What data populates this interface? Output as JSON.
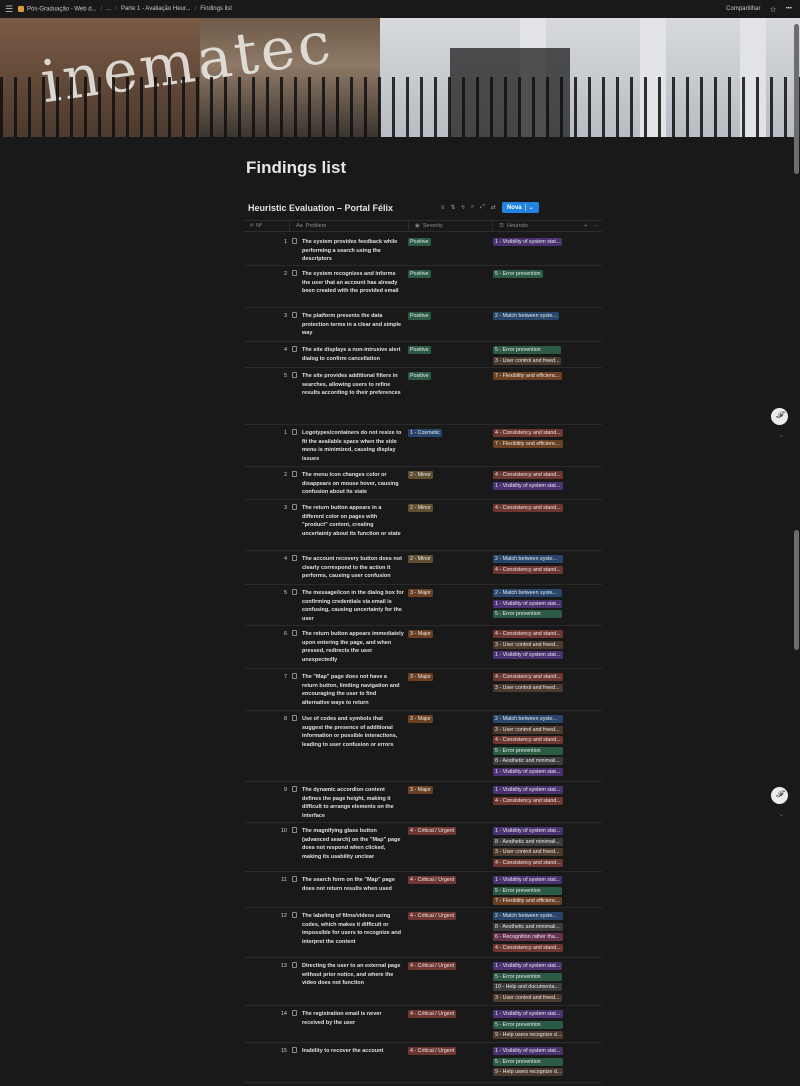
{
  "topbar": {
    "crumbs": [
      "Pós-Graduação - Web d...",
      "...",
      "Parte 1 - Avaliação Heur...",
      "Findings list"
    ],
    "share_label": "Compartilhar",
    "star_icon": "star-icon"
  },
  "cover": {
    "text": "inematec"
  },
  "page": {
    "title": "Findings list"
  },
  "database": {
    "title": "Heuristic Evaluation – Portal Félix",
    "new_label": "Nova",
    "columns": {
      "number": "Nº",
      "problem": "Problem",
      "severity": "Severity",
      "heuristic": "Heuristic"
    }
  },
  "colors": {
    "green": "#2b5a45",
    "blue": "#28456c",
    "yellow": "#5e5030",
    "orange": "#6a3f22",
    "red": "#6e3630",
    "purple": "#4a3270",
    "gray": "#3c3c3c",
    "brown": "#4d3a2f",
    "pink": "#67324e",
    "accent": "#2383e2"
  },
  "rows": [
    {
      "no": "1",
      "problem": "The system provides feedback while performing a search using the descriptors",
      "severity": {
        "label": "Positive",
        "color": "green"
      },
      "heuristics": [
        {
          "label": "1 - Visibility of system stat...",
          "color": "purple"
        }
      ]
    },
    {
      "no": "2",
      "problem": "The system recognizes and informs the user that an account has already been created with the provided email",
      "severity": {
        "label": "Positive",
        "color": "green"
      },
      "heuristics": [
        {
          "label": "5 - Error prevention",
          "color": "green"
        }
      ]
    },
    {
      "no": "3",
      "problem": "The platform presents the data protection terms in a clear and simple way",
      "severity": {
        "label": "Positive",
        "color": "green"
      },
      "heuristics": [
        {
          "label": "2 - Match between syste...",
          "color": "blue"
        }
      ]
    },
    {
      "no": "4",
      "problem": "The site displays a non-intrusive alert dialog to confirm cancellation",
      "severity": {
        "label": "Positive",
        "color": "green"
      },
      "heuristics": [
        {
          "label": "5 - Error prevention",
          "color": "green"
        },
        {
          "label": "3 - User control and freed...",
          "color": "brown"
        }
      ]
    },
    {
      "no": "5",
      "problem": "The site provides additional filters in searches, allowing users to refine results according to their preferences",
      "severity": {
        "label": "Positive",
        "color": "green"
      },
      "heuristics": [
        {
          "label": "7 - Flexibility and efficienc...",
          "color": "orange"
        }
      ]
    },
    {
      "no": "",
      "problem": "",
      "severity": null,
      "heuristics": []
    },
    {
      "no": "1",
      "problem": "Logotypes/containers do not resize to fit the available space when the side menu is minimized, causing display issues",
      "severity": {
        "label": "1 - Cosmetic",
        "color": "blue"
      },
      "heuristics": [
        {
          "label": "4 - Consistency and stand...",
          "color": "red"
        },
        {
          "label": "7 - Flexibility and efficienc...",
          "color": "orange"
        }
      ]
    },
    {
      "no": "2",
      "problem": "The menu icon changes color or disappears on mouse hover, causing confusion about its state",
      "severity": {
        "label": "2 - Minor",
        "color": "yellow"
      },
      "heuristics": [
        {
          "label": "4 - Consistency and stand...",
          "color": "red"
        },
        {
          "label": "1 - Visibility of system stat...",
          "color": "purple"
        }
      ]
    },
    {
      "no": "3",
      "problem": "The return button appears in a different color on pages with \"product\" content, creating uncertainty about its function or state",
      "severity": {
        "label": "2 - Minor",
        "color": "yellow"
      },
      "heuristics": [
        {
          "label": "4 - Consistency and stand...",
          "color": "red"
        }
      ]
    },
    {
      "no": "4",
      "problem": "The account recovery button does not clearly correspond to the action it performs, causing user confusion",
      "severity": {
        "label": "2 - Minor",
        "color": "yellow"
      },
      "heuristics": [
        {
          "label": "2 - Match between syste...",
          "color": "blue"
        },
        {
          "label": "4 - Consistency and stand...",
          "color": "red"
        }
      ]
    },
    {
      "no": "5",
      "problem": "The message/icon in the dialog box for confirming credentials via email is confusing, causing uncertainty for the user",
      "severity": {
        "label": "3 - Major",
        "color": "orange"
      },
      "heuristics": [
        {
          "label": "2 - Match between syste...",
          "color": "blue"
        },
        {
          "label": "1 - Visibility of system stat...",
          "color": "purple"
        },
        {
          "label": "5 - Error prevention",
          "color": "green"
        }
      ]
    },
    {
      "no": "6",
      "problem": "The return button appears immediately upon entering the page, and when pressed, redirects the user unexpectedly",
      "severity": {
        "label": "3 - Major",
        "color": "orange"
      },
      "heuristics": [
        {
          "label": "4 - Consistency and stand...",
          "color": "red"
        },
        {
          "label": "3 - User control and freed...",
          "color": "brown"
        },
        {
          "label": "1 - Visibility of system stat...",
          "color": "purple"
        }
      ]
    },
    {
      "no": "7",
      "problem": "The \"Map\" page does not have a return button, limiting navigation and encouraging the user to find alternative ways to return",
      "severity": {
        "label": "3 - Major",
        "color": "orange"
      },
      "heuristics": [
        {
          "label": "4 - Consistency and stand...",
          "color": "red"
        },
        {
          "label": "3 - User control and freed...",
          "color": "brown"
        }
      ]
    },
    {
      "no": "8",
      "problem": "Use of codes and symbols that suggest the presence of additional information or possible interactions, leading to user confusion or errors",
      "severity": {
        "label": "3 - Major",
        "color": "orange"
      },
      "heuristics": [
        {
          "label": "2 - Match between syste...",
          "color": "blue"
        },
        {
          "label": "3 - User control and freed...",
          "color": "brown"
        },
        {
          "label": "4 - Consistency and stand...",
          "color": "red"
        },
        {
          "label": "5 - Error prevention",
          "color": "green"
        },
        {
          "label": "8 - Aesthetic and minimali...",
          "color": "gray"
        },
        {
          "label": "1 - Visibility of system stat...",
          "color": "purple"
        }
      ]
    },
    {
      "no": "9",
      "problem": "The dynamic accordion content defines the page height, making it difficult to arrange elements on the interface",
      "severity": {
        "label": "3 - Major",
        "color": "orange"
      },
      "heuristics": [
        {
          "label": "1 - Visibility of system stat...",
          "color": "purple"
        },
        {
          "label": "4 - Consistency and stand...",
          "color": "red"
        }
      ]
    },
    {
      "no": "10",
      "problem": "The magnifying glass button (advanced search) on the \"Map\" page does not respond when clicked, making its usability unclear",
      "severity": {
        "label": "4 - Critical / Urgent",
        "color": "red"
      },
      "heuristics": [
        {
          "label": "1 - Visibility of system stat...",
          "color": "purple"
        },
        {
          "label": "8 - Aesthetic and minimali...",
          "color": "gray"
        },
        {
          "label": "3 - User control and freed...",
          "color": "brown"
        },
        {
          "label": "4 - Consistency and stand...",
          "color": "red"
        }
      ]
    },
    {
      "no": "11",
      "problem": "The search form on the \"Map\" page does not return results when used",
      "severity": {
        "label": "4 - Critical / Urgent",
        "color": "red"
      },
      "heuristics": [
        {
          "label": "1 - Visibility of system stat...",
          "color": "purple"
        },
        {
          "label": "5 - Error prevention",
          "color": "green"
        },
        {
          "label": "7 - Flexibility and efficienc...",
          "color": "orange"
        }
      ]
    },
    {
      "no": "12",
      "problem": "The labeling of films/videos using codes, which makes it difficult or impossible for users to recognize and interpret the content",
      "severity": {
        "label": "4 - Critical / Urgent",
        "color": "red"
      },
      "heuristics": [
        {
          "label": "2 - Match between syste...",
          "color": "blue"
        },
        {
          "label": "8 - Aesthetic and minimali...",
          "color": "gray"
        },
        {
          "label": "6 - Recognition rather tha...",
          "color": "pink"
        },
        {
          "label": "4 - Consistency and stand...",
          "color": "red"
        }
      ]
    },
    {
      "no": "13",
      "problem": "Directing the user to an external page without prior notice, and where the video does not function",
      "severity": {
        "label": "4 - Critical / Urgent",
        "color": "red"
      },
      "heuristics": [
        {
          "label": "1 - Visibility of system stat...",
          "color": "purple"
        },
        {
          "label": "5 - Error prevention",
          "color": "green"
        },
        {
          "label": "10 - Help and documenta...",
          "color": "gray"
        },
        {
          "label": "3 - User control and freed...",
          "color": "brown"
        }
      ]
    },
    {
      "no": "14",
      "problem": "The registration email is never received by the user",
      "severity": {
        "label": "4 - Critical / Urgent",
        "color": "red"
      },
      "heuristics": [
        {
          "label": "1 - Visibility of system stat...",
          "color": "purple"
        },
        {
          "label": "5 - Error prevention",
          "color": "green"
        },
        {
          "label": "9 - Help users recognize d...",
          "color": "brown"
        }
      ]
    },
    {
      "no": "15",
      "problem": "Inability to recover the account",
      "severity": {
        "label": "4 - Critical / Urgent",
        "color": "red"
      },
      "heuristics": [
        {
          "label": "1 - Visibility of system stat...",
          "color": "purple"
        },
        {
          "label": "5 - Error prevention",
          "color": "green"
        },
        {
          "label": "9 - Help users recognize d...",
          "color": "brown"
        }
      ]
    }
  ]
}
